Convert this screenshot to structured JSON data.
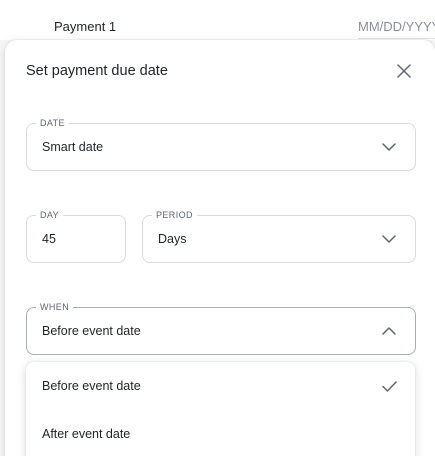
{
  "background_row": {
    "label": "Payment 1",
    "date_placeholder": "MM/DD/YYYY"
  },
  "panel": {
    "title": "Set payment due date",
    "close_icon": "close-icon"
  },
  "fields": {
    "date": {
      "legend": "DATE",
      "value": "Smart date",
      "icon": "chevron-down-icon"
    },
    "day": {
      "legend": "DAY",
      "value": "45"
    },
    "period": {
      "legend": "PERIOD",
      "value": "Days",
      "icon": "chevron-down-icon"
    },
    "when": {
      "legend": "WHEN",
      "value": "Before event date",
      "icon": "chevron-up-icon",
      "expanded": true
    }
  },
  "when_menu": {
    "items": [
      {
        "label": "Before event date",
        "selected": true,
        "icon": "check-icon"
      },
      {
        "label": "After event date",
        "selected": false
      }
    ]
  },
  "colors": {
    "icon": "#5f6672",
    "border": "#d7dade",
    "text": "#1f2328",
    "muted": "#8a8f98"
  }
}
